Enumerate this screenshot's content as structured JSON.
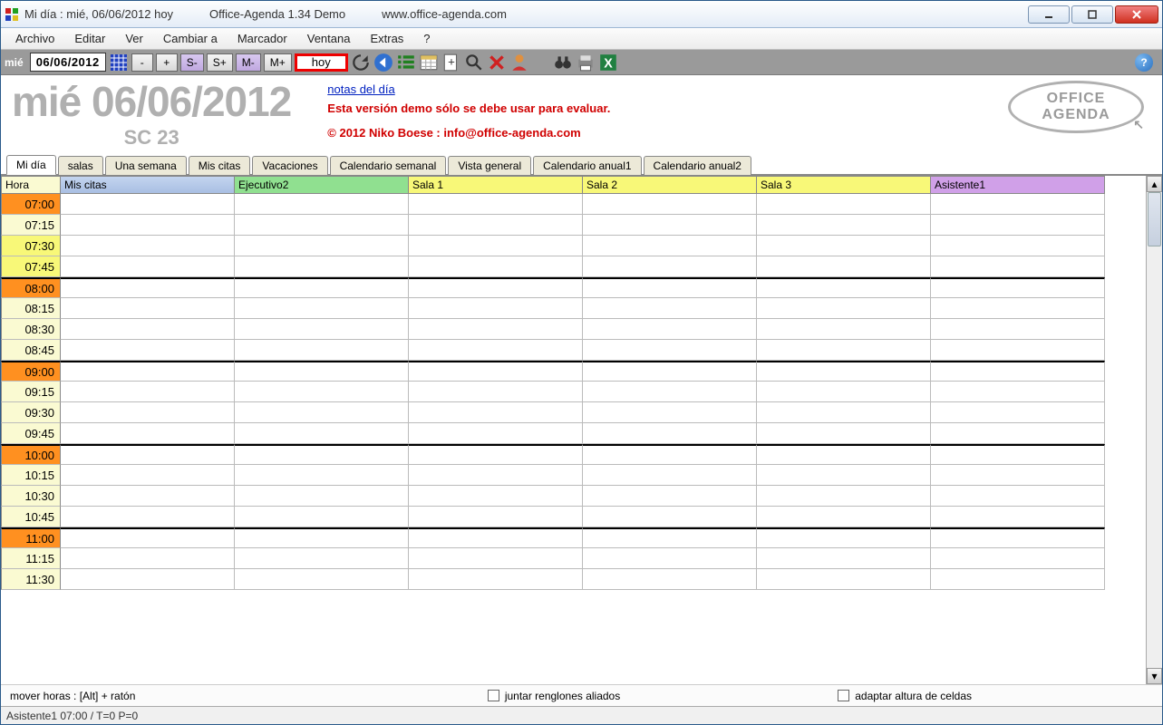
{
  "titlebar": {
    "title_main": "Mi día : mié, 06/06/2012 hoy",
    "title_app": "Office-Agenda 1.34 Demo",
    "title_url": "www.office-agenda.com"
  },
  "menu": {
    "items": [
      "Archivo",
      "Editar",
      "Ver",
      "Cambiar a",
      "Marcador",
      "Ventana",
      "Extras",
      "?"
    ]
  },
  "toolbar": {
    "day_label": "mié",
    "date_value": "06/06/2012",
    "btn_minus": "-",
    "btn_plus": "+",
    "btn_s_minus": "S-",
    "btn_s_plus": "S+",
    "btn_m_minus": "M-",
    "btn_m_plus": "M+",
    "btn_hoy": "hoy"
  },
  "header": {
    "big_date": "mié 06/06/2012",
    "sc": "SC 23",
    "notes_link": "notas del día",
    "demo_line": "Esta versión demo sólo se debe usar para evaluar.",
    "copyright": "© 2012 Niko Boese : info@office-agenda.com",
    "logo_line1": "OFFICE",
    "logo_line2": "AGENDA"
  },
  "tabs": [
    "Mi día",
    "salas",
    "Una semana",
    "Mis citas",
    "Vacaciones",
    "Calendario semanal",
    "Vista general",
    "Calendario anual1",
    "Calendario anual2"
  ],
  "columns": {
    "hora": "Hora",
    "c1": "Mis citas",
    "c2": "Ejecutivo2",
    "c3": "Sala 1",
    "c4": "Sala 2",
    "c5": "Sala 3",
    "c6": "Asistente1"
  },
  "time_rows": [
    {
      "t": "07:00",
      "cls": "time-orange",
      "top": false
    },
    {
      "t": "07:15",
      "cls": "time-ly",
      "top": false
    },
    {
      "t": "07:30",
      "cls": "time-yellow",
      "top": false
    },
    {
      "t": "07:45",
      "cls": "time-yellow",
      "top": false
    },
    {
      "t": "08:00",
      "cls": "time-orange",
      "top": true
    },
    {
      "t": "08:15",
      "cls": "time-ly",
      "top": false
    },
    {
      "t": "08:30",
      "cls": "time-ly",
      "top": false
    },
    {
      "t": "08:45",
      "cls": "time-ly",
      "top": false
    },
    {
      "t": "09:00",
      "cls": "time-orange",
      "top": true
    },
    {
      "t": "09:15",
      "cls": "time-ly",
      "top": false
    },
    {
      "t": "09:30",
      "cls": "time-ly",
      "top": false
    },
    {
      "t": "09:45",
      "cls": "time-ly",
      "top": false
    },
    {
      "t": "10:00",
      "cls": "time-orange",
      "top": true
    },
    {
      "t": "10:15",
      "cls": "time-ly",
      "top": false
    },
    {
      "t": "10:30",
      "cls": "time-ly",
      "top": false
    },
    {
      "t": "10:45",
      "cls": "time-ly",
      "top": false
    },
    {
      "t": "11:00",
      "cls": "time-orange",
      "top": true
    },
    {
      "t": "11:15",
      "cls": "time-ly",
      "top": false
    },
    {
      "t": "11:30",
      "cls": "time-ly",
      "top": false
    }
  ],
  "bottom": {
    "hint": "mover horas : [Alt] + ratón",
    "chk1": "juntar renglones aliados",
    "chk2": "adaptar altura de celdas"
  },
  "status": "Asistente1 07:00  / T=0  P=0"
}
